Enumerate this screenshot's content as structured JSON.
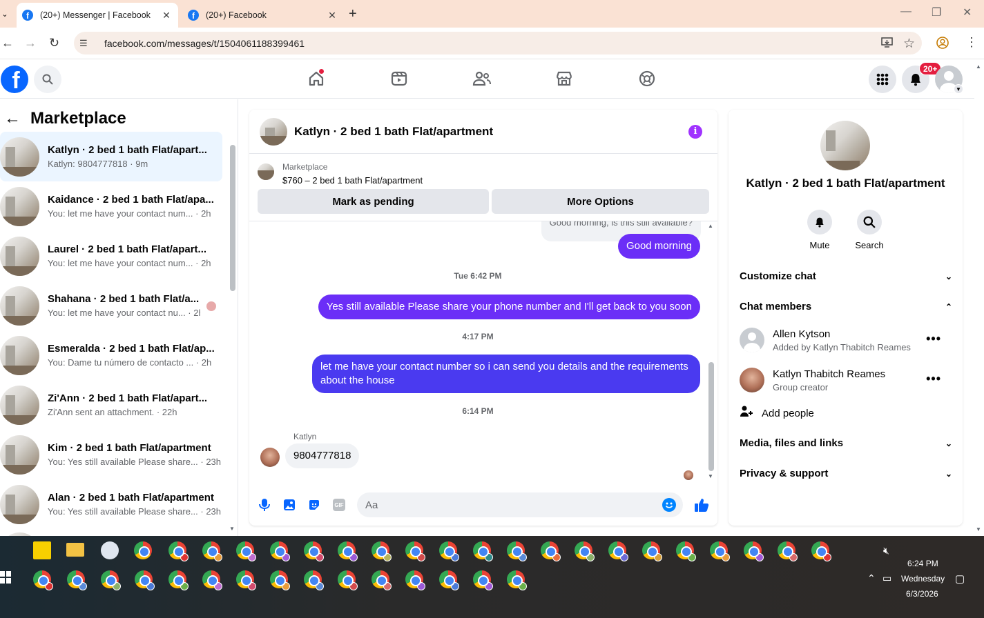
{
  "browser": {
    "tabs": [
      {
        "title": "(20+) Messenger | Facebook",
        "active": true
      },
      {
        "title": "(20+) Facebook",
        "active": false
      }
    ],
    "new_tab": "+",
    "url": "facebook.com/messages/t/1504061188399461",
    "icons": [
      "back-icon",
      "forward-icon",
      "reload-icon",
      "site-info-icon",
      "install-icon",
      "bookmark-star-icon",
      "profile-icon",
      "menu-icon"
    ]
  },
  "fb_header": {
    "logo": "f",
    "notifications_badge": "20+",
    "nav_icons": [
      "home-icon",
      "video-icon",
      "friends-icon",
      "marketplace-icon",
      "gaming-icon"
    ]
  },
  "sidebar": {
    "back_icon": "←",
    "title": "Marketplace",
    "conversations": [
      {
        "name": "Katlyn · 2 bed 1 bath Flat/apart...",
        "preview": "Katlyn: 9804777818 · 9m",
        "active": true
      },
      {
        "name": "Kaidance · 2 bed 1 bath Flat/apa...",
        "preview": "You: let me have your contact num... · 2h"
      },
      {
        "name": "Laurel · 2 bed 1 bath Flat/apart...",
        "preview": "You: let me have your contact num... · 2h"
      },
      {
        "name": "Shahana · 2 bed 1 bath Flat/a...",
        "preview": "You: let me have your contact nu... · 2h"
      },
      {
        "name": "Esmeralda · 2 bed 1 bath Flat/ap...",
        "preview": "You: Dame tu número de contacto ... · 2h"
      },
      {
        "name": "Zi'Ann · 2 bed 1 bath Flat/apart...",
        "preview": "Zi'Ann sent an attachment. · 22h"
      },
      {
        "name": "Kim · 2 bed 1 bath Flat/apartment",
        "preview": "You: Yes still available Please share... · 23h"
      },
      {
        "name": "Alan · 2 bed 1 bath Flat/apartment",
        "preview": "You: Yes still available Please share... · 23h"
      }
    ]
  },
  "chat": {
    "title": "Katlyn · 2 bed 1 bath Flat/apartment",
    "info_icon": "i",
    "listing_source": "Marketplace",
    "listing_title": "$760 – 2 bed 1 bath Flat/apartment",
    "buttons": {
      "pending": "Mark as pending",
      "more": "More Options"
    },
    "quoted_reply": "Good morning, is this still available?",
    "messages": {
      "m1": "Good morning",
      "ts1": "Tue 6:42 PM",
      "m2": "Yes still available Please share your phone number and I'll get back to you soon",
      "ts2": "4:17 PM",
      "m3": "let me have your contact number so i can send you details and the requirements about the house",
      "ts3": "6:14 PM",
      "sender": "Katlyn",
      "m4": "9804777818"
    },
    "composer_placeholder": "Aa",
    "composer_icons": [
      "mic-icon",
      "photo-icon",
      "sticker-icon",
      "gif-icon",
      "emoji-icon",
      "like-icon"
    ],
    "gif_label": "GIF"
  },
  "info_panel": {
    "title": "Katlyn · 2 bed 1 bath Flat/apartment",
    "actions": {
      "mute": "Mute",
      "search": "Search"
    },
    "sections": {
      "customize": "Customize chat",
      "members": "Chat members",
      "media": "Media, files and links",
      "privacy": "Privacy & support"
    },
    "members": [
      {
        "name": "Allen Kytson",
        "sub": "Added by Katlyn Thabitch Reames"
      },
      {
        "name": "Katlyn Thabitch Reames",
        "sub": "Group creator"
      }
    ],
    "add_people": "Add people",
    "more": "•••"
  },
  "taskbar": {
    "time": "6:24 PM",
    "day": "Wednesday",
    "date": "6/3/2026"
  },
  "colors": {
    "accent_purple": "#6b2ef7",
    "fb_blue": "#0866ff",
    "badge_red": "#e41e3f"
  }
}
